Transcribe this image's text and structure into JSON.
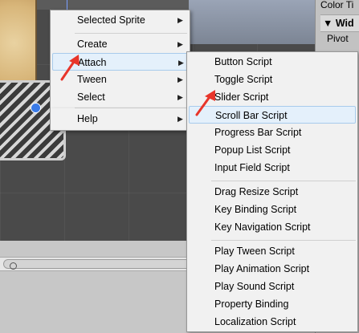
{
  "inspector": {
    "color_tint_label": "Color Ti",
    "widget_header": "▼ Wid",
    "pivot_label": "Pivot"
  },
  "context_menu": {
    "items": [
      {
        "label": "Selected Sprite",
        "has_submenu": true
      },
      {
        "label": "Create",
        "has_submenu": true
      },
      {
        "label": "Attach",
        "has_submenu": true,
        "highlighted": true
      },
      {
        "label": "Tween",
        "has_submenu": true
      },
      {
        "label": "Select",
        "has_submenu": true
      },
      {
        "label": "Help",
        "has_submenu": true
      }
    ]
  },
  "attach_submenu": {
    "groups": [
      [
        "Button Script",
        "Toggle Script",
        "Slider Script",
        "Scroll Bar Script",
        "Progress Bar Script",
        "Popup List Script",
        "Input Field Script"
      ],
      [
        "Drag Resize Script",
        "Key Binding Script",
        "Key Navigation Script"
      ],
      [
        "Play Tween Script",
        "Play Animation Script",
        "Play Sound Script",
        "Property Binding",
        "Localization Script"
      ]
    ],
    "highlighted": "Scroll Bar Script"
  },
  "colors": {
    "menu_bg": "#f1f1f1",
    "highlight_bg": "#e4f0fb",
    "highlight_border": "#a8cbec",
    "annotation_arrow": "#e8352a",
    "selection_handle": "#3a7be8"
  },
  "icons": {
    "submenu_arrow": "▶",
    "search": "search-icon"
  }
}
